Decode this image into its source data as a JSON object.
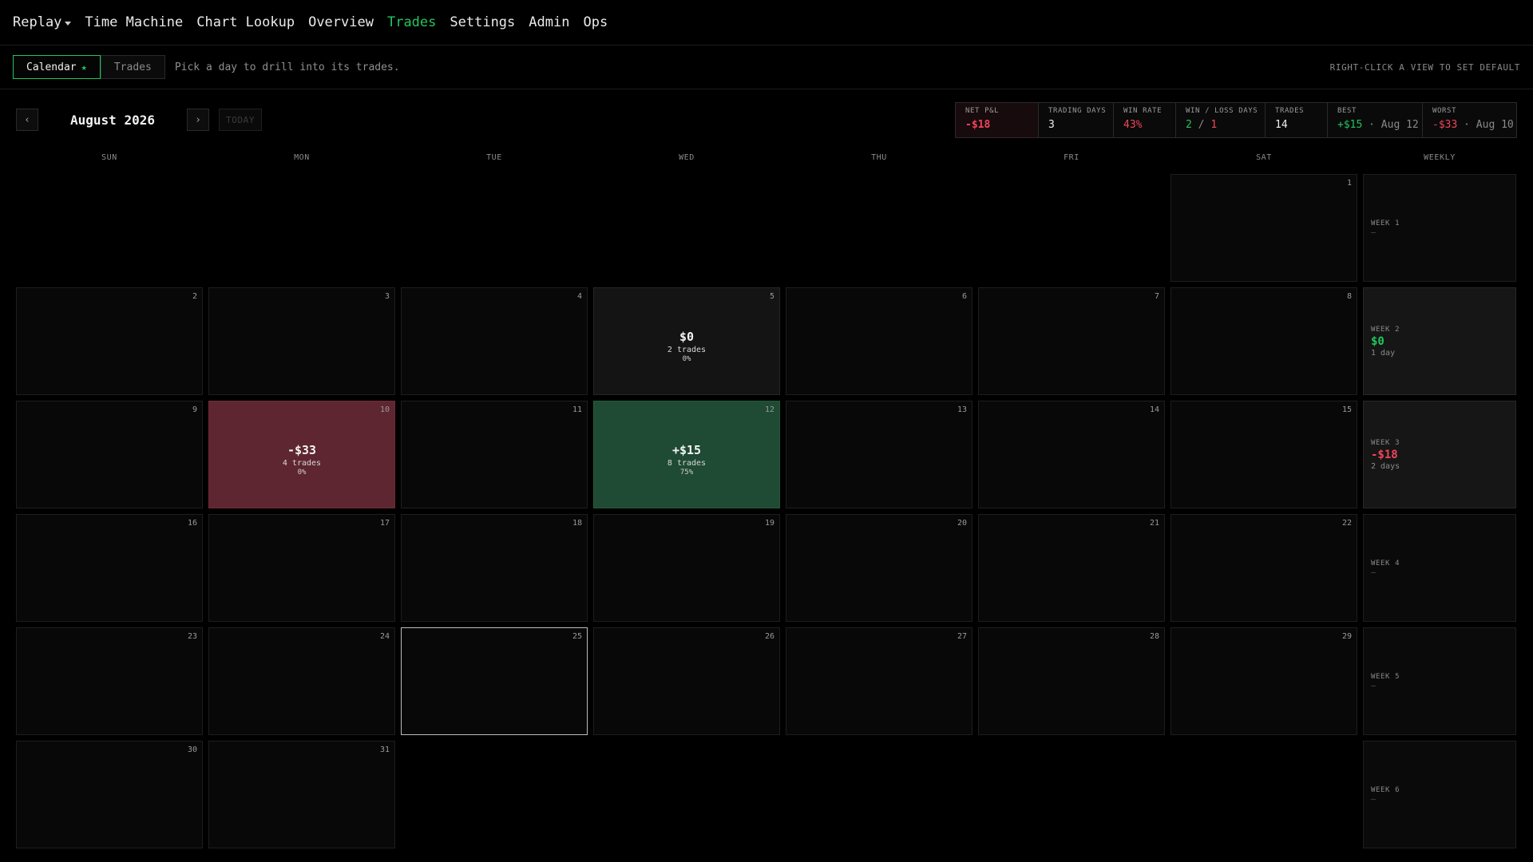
{
  "nav": {
    "replay": "Replay",
    "time_machine": "Time Machine",
    "chart_lookup": "Chart Lookup",
    "overview": "Overview",
    "trades": "Trades",
    "settings": "Settings",
    "admin": "Admin",
    "ops": "Ops",
    "active": "trades"
  },
  "subbar": {
    "calendar_tab": "Calendar",
    "calendar_star": "★",
    "trades_tab": "Trades",
    "hint": "Pick a day to drill into its trades.",
    "right_hint": "RIGHT-CLICK A VIEW TO SET DEFAULT"
  },
  "month": {
    "prev": "‹",
    "next": "›",
    "title": "August 2026",
    "today": "TODAY"
  },
  "stats": {
    "net_pnl": {
      "label": "NET P&L",
      "value": "-$18"
    },
    "trading_days": {
      "label": "TRADING DAYS",
      "value": "3"
    },
    "win_rate": {
      "label": "WIN RATE",
      "value": "43%"
    },
    "win_loss_days": {
      "label": "WIN / LOSS DAYS",
      "wins": "2",
      "sep": "/",
      "losses": "1"
    },
    "trades": {
      "label": "TRADES",
      "value": "14"
    },
    "best": {
      "label": "BEST",
      "value": "+$15",
      "dot": "·",
      "date": "Aug 12"
    },
    "worst": {
      "label": "WORST",
      "value": "-$33",
      "dot": "·",
      "date": "Aug 10"
    }
  },
  "weekdays": [
    "SUN",
    "MON",
    "TUE",
    "WED",
    "THU",
    "FRI",
    "SAT"
  ],
  "weekly_header": "WEEKLY",
  "days": {
    "d1": "1",
    "d2": "2",
    "d3": "3",
    "d4": "4",
    "d5": "5",
    "d6": "6",
    "d7": "7",
    "d8": "8",
    "d9": "9",
    "d10": "10",
    "d11": "11",
    "d12": "12",
    "d13": "13",
    "d14": "14",
    "d15": "15",
    "d16": "16",
    "d17": "17",
    "d18": "18",
    "d19": "19",
    "d20": "20",
    "d21": "21",
    "d22": "22",
    "d23": "23",
    "d24": "24",
    "d25": "25",
    "d26": "26",
    "d27": "27",
    "d28": "28",
    "d29": "29",
    "d30": "30",
    "d31": "31"
  },
  "day_stats": {
    "d5": {
      "pnl": "$0",
      "trades": "2 trades",
      "wr": "0%"
    },
    "d10": {
      "pnl": "-$33",
      "trades": "4 trades",
      "wr": "0%"
    },
    "d12": {
      "pnl": "+$15",
      "trades": "8 trades",
      "wr": "75%"
    }
  },
  "weeks": [
    {
      "label": "WEEK 1",
      "value": "–"
    },
    {
      "label": "WEEK 2",
      "value": "$0",
      "sub": "1 day"
    },
    {
      "label": "WEEK 3",
      "value": "-$18",
      "sub": "2 days"
    },
    {
      "label": "WEEK 4",
      "value": "–"
    },
    {
      "label": "WEEK 5",
      "value": "–"
    },
    {
      "label": "WEEK 6",
      "value": "–"
    }
  ],
  "colors": {
    "accent": "#22c55e",
    "negative": "#f0455a",
    "loss_cell": "#5e2630",
    "win_cell": "#1f4a33"
  }
}
